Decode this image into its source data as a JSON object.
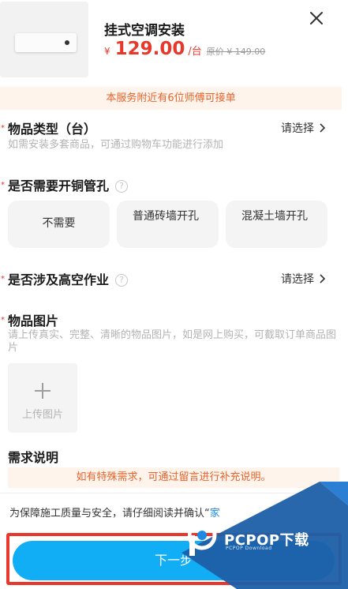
{
  "product": {
    "title": "挂式空调安装",
    "currency": "¥",
    "price": "129.00",
    "unit": "/台",
    "original_price": "原价 ¥ 149.00"
  },
  "notice": "本服务附近有6位师傅可接单",
  "item_type": {
    "title": "物品类型（台）",
    "hint": "如需安装多套商品，可通过购物车功能进行添加",
    "select_label": "请选择"
  },
  "copper_pipe": {
    "title": "是否需要开铜管孔",
    "help_icon": "?",
    "options": [
      "不需要",
      "普通砖墙开孔",
      "混凝土墙开孔"
    ]
  },
  "high_altitude": {
    "title": "是否涉及高空作业",
    "help_icon": "?",
    "select_label": "请选择"
  },
  "photos": {
    "title": "物品图片",
    "hint": "请上传真实、完整、清晰的物品图片，如是网上购买，可截取订单商品图片",
    "upload_label": "上传图片"
  },
  "requirements": {
    "title": "需求说明",
    "placeholder": "如有特殊需求，可通过留言进行补充说明。"
  },
  "consent": {
    "text": "为保障施工质量与安全，请仔细阅读并确认“",
    "link": "家"
  },
  "next_button": "下一步",
  "watermark": {
    "brand": "PCPOP下载",
    "sub": "PCPOP Download"
  },
  "colors": {
    "accent_red": "#e8382b",
    "notice_orange": "#e8632b",
    "button_blue": "#11aef5",
    "watermark_blue": "#1e5fa8"
  },
  "icons": [
    "close-icon",
    "chevron-right-icon",
    "question-icon",
    "plus-icon"
  ]
}
